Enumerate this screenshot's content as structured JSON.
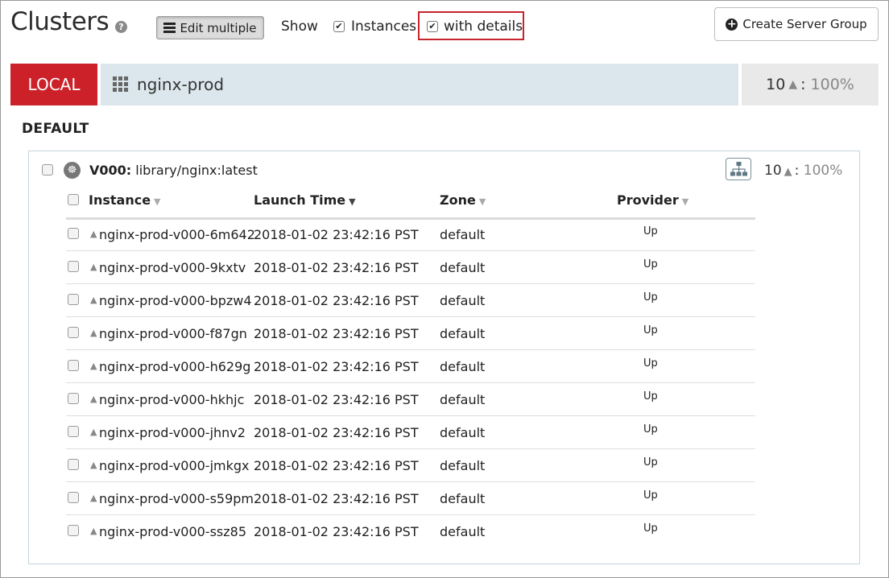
{
  "header": {
    "title": "Clusters",
    "help_icon": "?",
    "edit_multiple_label": "Edit multiple",
    "show_label": "Show",
    "instances_label": "Instances",
    "instances_checked": true,
    "with_details_label": "with details",
    "with_details_checked": true,
    "create_server_group_label": "Create Server Group"
  },
  "cluster": {
    "account": "LOCAL",
    "account_color": "#cc2129",
    "name": "nginx-prod",
    "health_count": "10",
    "health_pct": "100%"
  },
  "region": "DEFAULT",
  "server_group": {
    "version": "V000:",
    "image": "library/nginx:latest",
    "health_count": "10",
    "health_pct": "100%",
    "columns": [
      {
        "label": "Instance",
        "sort": "▼"
      },
      {
        "label": "Launch Time",
        "sort": "▼"
      },
      {
        "label": "Zone",
        "sort": "▼"
      },
      {
        "label": "Provider",
        "sort": "▼"
      }
    ],
    "rows": [
      {
        "instance": "nginx-prod-v000-6m642",
        "launch": "2018-01-02 23:42:16 PST",
        "zone": "default",
        "provider": "Up"
      },
      {
        "instance": "nginx-prod-v000-9kxtv",
        "launch": "2018-01-02 23:42:16 PST",
        "zone": "default",
        "provider": "Up"
      },
      {
        "instance": "nginx-prod-v000-bpzw4",
        "launch": "2018-01-02 23:42:16 PST",
        "zone": "default",
        "provider": "Up"
      },
      {
        "instance": "nginx-prod-v000-f87gn",
        "launch": "2018-01-02 23:42:16 PST",
        "zone": "default",
        "provider": "Up"
      },
      {
        "instance": "nginx-prod-v000-h629g",
        "launch": "2018-01-02 23:42:16 PST",
        "zone": "default",
        "provider": "Up"
      },
      {
        "instance": "nginx-prod-v000-hkhjc",
        "launch": "2018-01-02 23:42:16 PST",
        "zone": "default",
        "provider": "Up"
      },
      {
        "instance": "nginx-prod-v000-jhnv2",
        "launch": "2018-01-02 23:42:16 PST",
        "zone": "default",
        "provider": "Up"
      },
      {
        "instance": "nginx-prod-v000-jmkgx",
        "launch": "2018-01-02 23:42:16 PST",
        "zone": "default",
        "provider": "Up"
      },
      {
        "instance": "nginx-prod-v000-s59pm",
        "launch": "2018-01-02 23:42:16 PST",
        "zone": "default",
        "provider": "Up"
      },
      {
        "instance": "nginx-prod-v000-ssz85",
        "launch": "2018-01-02 23:42:16 PST",
        "zone": "default",
        "provider": "Up"
      }
    ]
  }
}
